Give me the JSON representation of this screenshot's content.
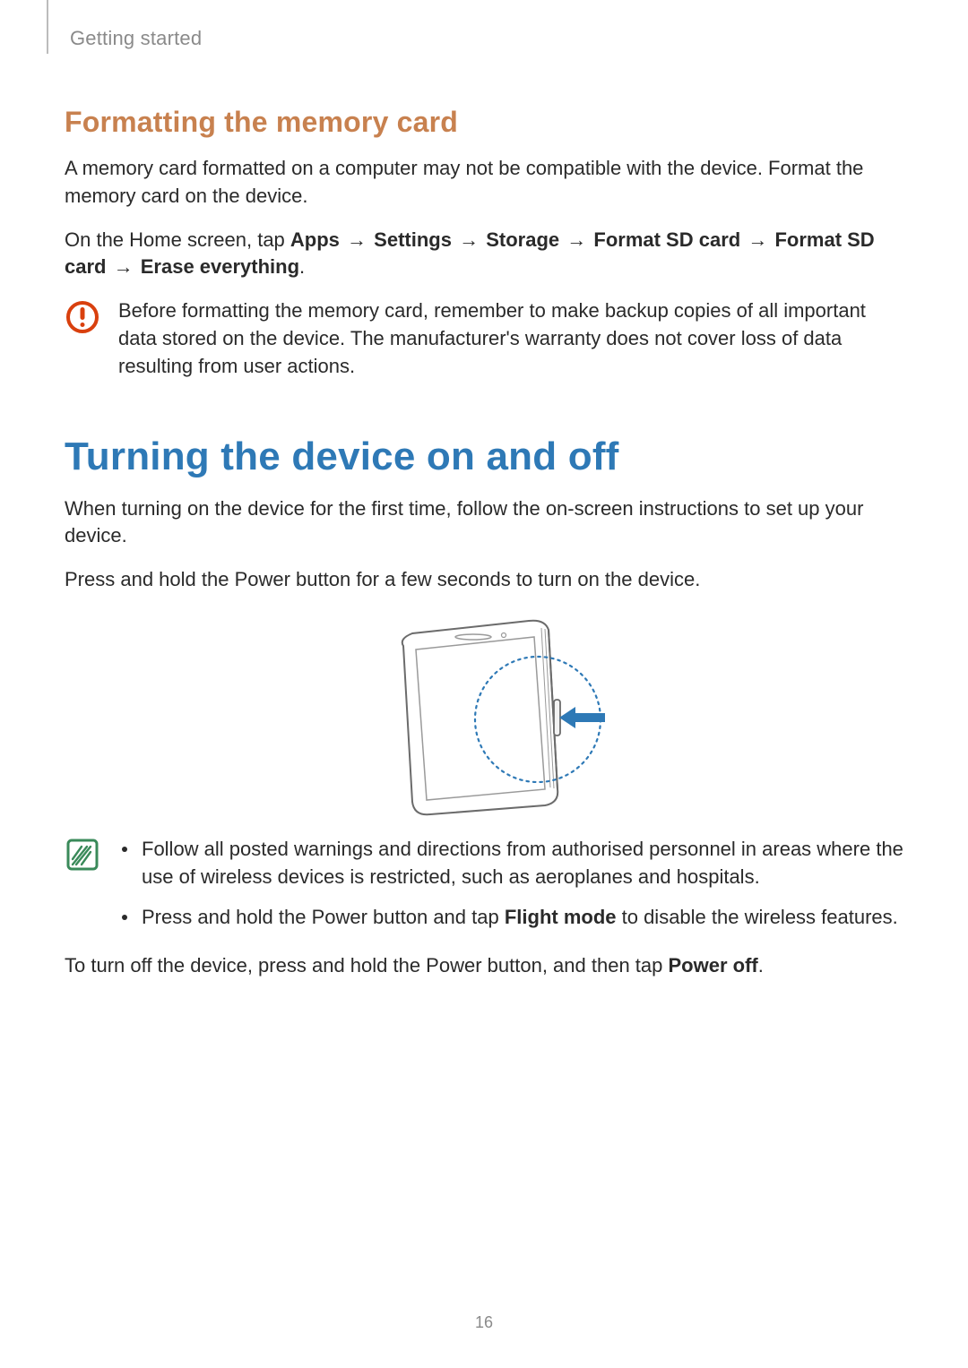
{
  "header": {
    "section": "Getting started"
  },
  "section1": {
    "heading": "Formatting the memory card",
    "para1": "A memory card formatted on a computer may not be compatible with the device. Format the memory card on the device.",
    "para2": {
      "lead": "On the Home screen, tap ",
      "steps": [
        "Apps",
        "Settings",
        "Storage",
        "Format SD card",
        "Format SD card",
        "Erase everything"
      ],
      "trail": "."
    },
    "warning": "Before formatting the memory card, remember to make backup copies of all important data stored on the device. The manufacturer's warranty does not cover loss of data resulting from user actions."
  },
  "section2": {
    "heading": "Turning the device on and off",
    "para1": "When turning on the device for the first time, follow the on-screen instructions to set up your device.",
    "para2": "Press and hold the Power button for a few seconds to turn on the device.",
    "notes": {
      "item1": "Follow all posted warnings and directions from authorised personnel in areas where the use of wireless devices is restricted, such as aeroplanes and hospitals.",
      "item2_lead": "Press and hold the Power button and tap ",
      "item2_bold": "Flight mode",
      "item2_trail": " to disable the wireless features."
    },
    "para3_lead": "To turn off the device, press and hold the Power button, and then tap ",
    "para3_bold": "Power off",
    "para3_trail": "."
  },
  "page_number": "16",
  "arrow": "→"
}
